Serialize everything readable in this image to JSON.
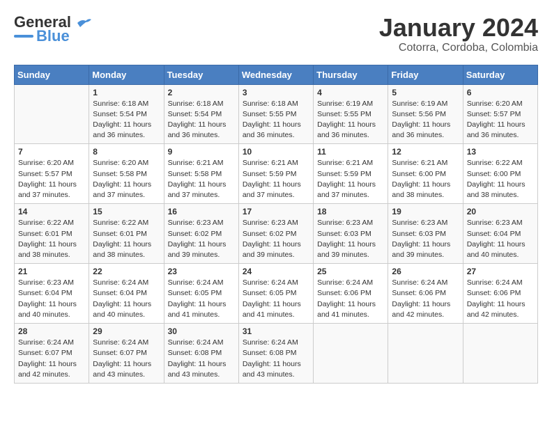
{
  "logo": {
    "line1": "General",
    "line2": "Blue"
  },
  "title": "January 2024",
  "location": "Cotorra, Cordoba, Colombia",
  "weekdays": [
    "Sunday",
    "Monday",
    "Tuesday",
    "Wednesday",
    "Thursday",
    "Friday",
    "Saturday"
  ],
  "weeks": [
    [
      {
        "day": "",
        "info": ""
      },
      {
        "day": "1",
        "info": "Sunrise: 6:18 AM\nSunset: 5:54 PM\nDaylight: 11 hours\nand 36 minutes."
      },
      {
        "day": "2",
        "info": "Sunrise: 6:18 AM\nSunset: 5:54 PM\nDaylight: 11 hours\nand 36 minutes."
      },
      {
        "day": "3",
        "info": "Sunrise: 6:18 AM\nSunset: 5:55 PM\nDaylight: 11 hours\nand 36 minutes."
      },
      {
        "day": "4",
        "info": "Sunrise: 6:19 AM\nSunset: 5:55 PM\nDaylight: 11 hours\nand 36 minutes."
      },
      {
        "day": "5",
        "info": "Sunrise: 6:19 AM\nSunset: 5:56 PM\nDaylight: 11 hours\nand 36 minutes."
      },
      {
        "day": "6",
        "info": "Sunrise: 6:20 AM\nSunset: 5:57 PM\nDaylight: 11 hours\nand 36 minutes."
      }
    ],
    [
      {
        "day": "7",
        "info": "Sunrise: 6:20 AM\nSunset: 5:57 PM\nDaylight: 11 hours\nand 37 minutes."
      },
      {
        "day": "8",
        "info": "Sunrise: 6:20 AM\nSunset: 5:58 PM\nDaylight: 11 hours\nand 37 minutes."
      },
      {
        "day": "9",
        "info": "Sunrise: 6:21 AM\nSunset: 5:58 PM\nDaylight: 11 hours\nand 37 minutes."
      },
      {
        "day": "10",
        "info": "Sunrise: 6:21 AM\nSunset: 5:59 PM\nDaylight: 11 hours\nand 37 minutes."
      },
      {
        "day": "11",
        "info": "Sunrise: 6:21 AM\nSunset: 5:59 PM\nDaylight: 11 hours\nand 37 minutes."
      },
      {
        "day": "12",
        "info": "Sunrise: 6:21 AM\nSunset: 6:00 PM\nDaylight: 11 hours\nand 38 minutes."
      },
      {
        "day": "13",
        "info": "Sunrise: 6:22 AM\nSunset: 6:00 PM\nDaylight: 11 hours\nand 38 minutes."
      }
    ],
    [
      {
        "day": "14",
        "info": "Sunrise: 6:22 AM\nSunset: 6:01 PM\nDaylight: 11 hours\nand 38 minutes."
      },
      {
        "day": "15",
        "info": "Sunrise: 6:22 AM\nSunset: 6:01 PM\nDaylight: 11 hours\nand 38 minutes."
      },
      {
        "day": "16",
        "info": "Sunrise: 6:23 AM\nSunset: 6:02 PM\nDaylight: 11 hours\nand 39 minutes."
      },
      {
        "day": "17",
        "info": "Sunrise: 6:23 AM\nSunset: 6:02 PM\nDaylight: 11 hours\nand 39 minutes."
      },
      {
        "day": "18",
        "info": "Sunrise: 6:23 AM\nSunset: 6:03 PM\nDaylight: 11 hours\nand 39 minutes."
      },
      {
        "day": "19",
        "info": "Sunrise: 6:23 AM\nSunset: 6:03 PM\nDaylight: 11 hours\nand 39 minutes."
      },
      {
        "day": "20",
        "info": "Sunrise: 6:23 AM\nSunset: 6:04 PM\nDaylight: 11 hours\nand 40 minutes."
      }
    ],
    [
      {
        "day": "21",
        "info": "Sunrise: 6:23 AM\nSunset: 6:04 PM\nDaylight: 11 hours\nand 40 minutes."
      },
      {
        "day": "22",
        "info": "Sunrise: 6:24 AM\nSunset: 6:04 PM\nDaylight: 11 hours\nand 40 minutes."
      },
      {
        "day": "23",
        "info": "Sunrise: 6:24 AM\nSunset: 6:05 PM\nDaylight: 11 hours\nand 41 minutes."
      },
      {
        "day": "24",
        "info": "Sunrise: 6:24 AM\nSunset: 6:05 PM\nDaylight: 11 hours\nand 41 minutes."
      },
      {
        "day": "25",
        "info": "Sunrise: 6:24 AM\nSunset: 6:06 PM\nDaylight: 11 hours\nand 41 minutes."
      },
      {
        "day": "26",
        "info": "Sunrise: 6:24 AM\nSunset: 6:06 PM\nDaylight: 11 hours\nand 42 minutes."
      },
      {
        "day": "27",
        "info": "Sunrise: 6:24 AM\nSunset: 6:06 PM\nDaylight: 11 hours\nand 42 minutes."
      }
    ],
    [
      {
        "day": "28",
        "info": "Sunrise: 6:24 AM\nSunset: 6:07 PM\nDaylight: 11 hours\nand 42 minutes."
      },
      {
        "day": "29",
        "info": "Sunrise: 6:24 AM\nSunset: 6:07 PM\nDaylight: 11 hours\nand 43 minutes."
      },
      {
        "day": "30",
        "info": "Sunrise: 6:24 AM\nSunset: 6:08 PM\nDaylight: 11 hours\nand 43 minutes."
      },
      {
        "day": "31",
        "info": "Sunrise: 6:24 AM\nSunset: 6:08 PM\nDaylight: 11 hours\nand 43 minutes."
      },
      {
        "day": "",
        "info": ""
      },
      {
        "day": "",
        "info": ""
      },
      {
        "day": "",
        "info": ""
      }
    ]
  ]
}
